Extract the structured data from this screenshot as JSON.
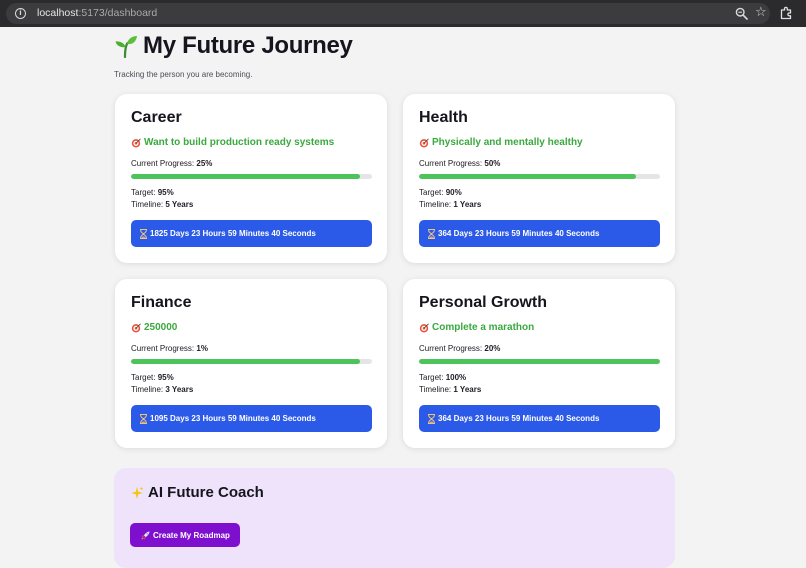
{
  "browser": {
    "url_host": "localhost",
    "url_path": ":5173/dashboard"
  },
  "header": {
    "title": "My Future Journey",
    "subtitle": "Tracking the person you are becoming."
  },
  "cards": [
    {
      "title": "Career",
      "goal": "Want to build production ready systems",
      "progress_label": "Current Progress:",
      "progress_value": "25%",
      "target_label": "Target:",
      "target_value": "95%",
      "timeline_label": "Timeline:",
      "timeline_value": "5 Years",
      "countdown": "1825 Days 23 Hours 59 Minutes 40 Seconds",
      "bar_fill": 0.95
    },
    {
      "title": "Health",
      "goal": "Physically and mentally healthy",
      "progress_label": "Current Progress:",
      "progress_value": "50%",
      "target_label": "Target:",
      "target_value": "90%",
      "timeline_label": "Timeline:",
      "timeline_value": "1 Years",
      "countdown": "364 Days 23 Hours 59 Minutes 40 Seconds",
      "bar_fill": 0.9
    },
    {
      "title": "Finance",
      "goal": "250000",
      "progress_label": "Current Progress:",
      "progress_value": "1%",
      "target_label": "Target:",
      "target_value": "95%",
      "timeline_label": "Timeline:",
      "timeline_value": "3 Years",
      "countdown": "1095 Days 23 Hours 59 Minutes 40 Seconds",
      "bar_fill": 0.95
    },
    {
      "title": "Personal Growth",
      "goal": "Complete a marathon",
      "progress_label": "Current Progress:",
      "progress_value": "20%",
      "target_label": "Target:",
      "target_value": "100%",
      "timeline_label": "Timeline:",
      "timeline_value": "1 Years",
      "countdown": "364 Days 23 Hours 59 Minutes 40 Seconds",
      "bar_fill": 1.0
    }
  ],
  "coach": {
    "title": "AI Future Coach",
    "button_label": "Create My Roadmap"
  },
  "icons": {
    "header": "sprout-icon",
    "goal": "target-icon",
    "countdown": "hourglass-icon",
    "coach": "sparkle-icon",
    "button": "rocket-icon"
  },
  "colors": {
    "goal_text": "#3aa93f",
    "progress_fill": "#4cc35b",
    "countdown_bg": "#2c5ae8",
    "coach_bg": "#efe3fb",
    "coach_button": "#7f0fcf"
  }
}
